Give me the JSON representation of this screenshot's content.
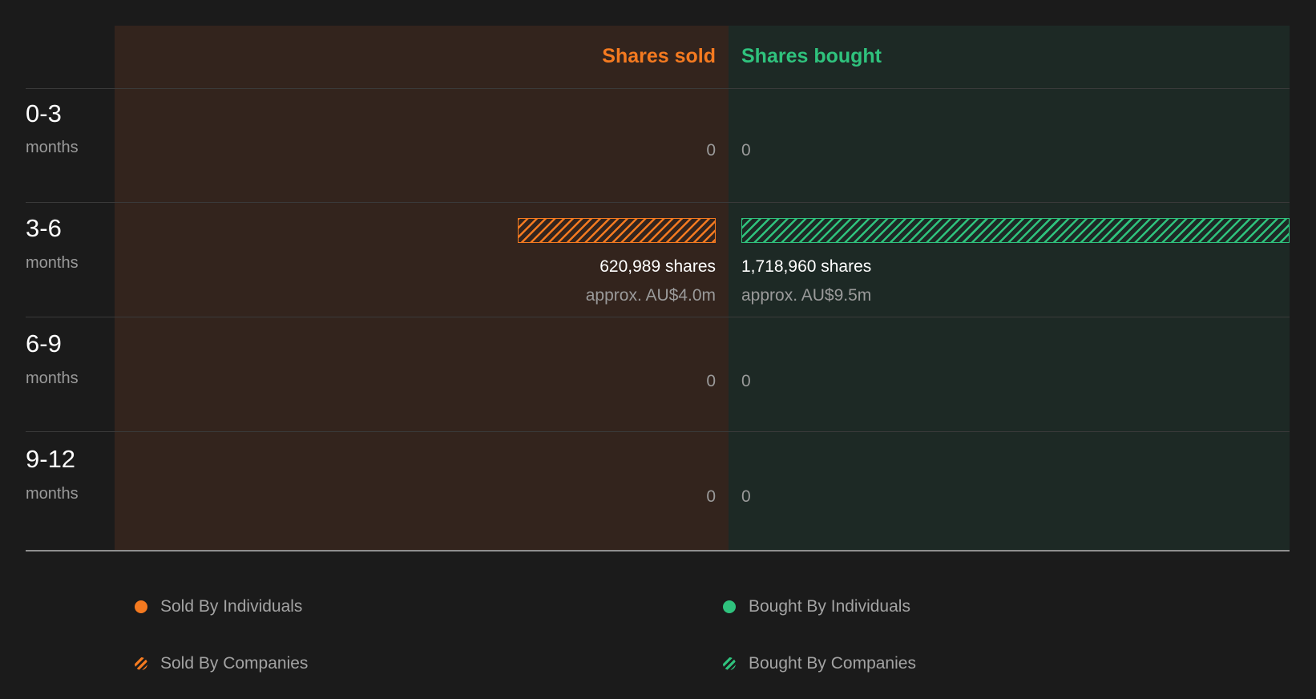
{
  "chart_data": {
    "type": "bar",
    "orientation": "horizontal-diverging",
    "columns": {
      "left": "Shares sold",
      "right": "Shares bought"
    },
    "categories": [
      {
        "main": "0-3",
        "sub": "months"
      },
      {
        "main": "3-6",
        "sub": "months"
      },
      {
        "main": "6-9",
        "sub": "months"
      },
      {
        "main": "9-12",
        "sub": "months"
      }
    ],
    "series": [
      {
        "name": "Shares sold",
        "side": "left",
        "color": "#f47a20",
        "values": [
          0,
          620989,
          0,
          0
        ],
        "labels": [
          "0",
          "620,989 shares",
          "0",
          "0"
        ],
        "approx_value": [
          "",
          "approx. AU$4.0m",
          "",
          ""
        ]
      },
      {
        "name": "Shares bought",
        "side": "right",
        "color": "#2fc27d",
        "values": [
          0,
          1718960,
          0,
          0
        ],
        "labels": [
          "0",
          "1,718,960 shares",
          "0",
          "0"
        ],
        "approx_value": [
          "",
          "approx. AU$9.5m",
          "",
          ""
        ]
      }
    ],
    "legend": [
      {
        "label": "Sold By Individuals",
        "style": "solid",
        "color": "#f47a20"
      },
      {
        "label": "Bought By Individuals",
        "style": "solid",
        "color": "#2fc27d"
      },
      {
        "label": "Sold By Companies",
        "style": "hatched",
        "color": "#f47a20"
      },
      {
        "label": "Bought By Companies",
        "style": "hatched",
        "color": "#2fc27d"
      }
    ],
    "legend_placement": "bottom",
    "scale_max": 1718960
  },
  "colors": {
    "background": "#1b1b1b",
    "sold_panel": "#33241d",
    "bought_panel": "#1d2925",
    "sold_accent": "#f47a20",
    "bought_accent": "#2fc27d"
  }
}
